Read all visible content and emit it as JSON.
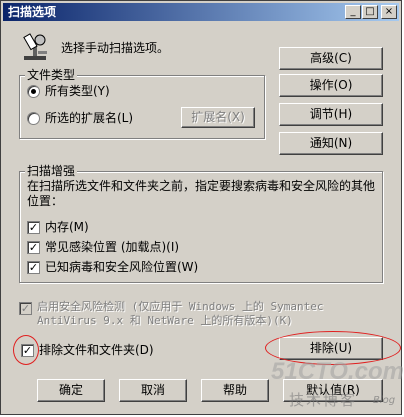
{
  "window": {
    "title": "扫描选项",
    "controls": {
      "minimize": "_",
      "maximize": "□",
      "close": "×"
    }
  },
  "header": {
    "instruction": "选择手动扫描选项。",
    "icon": "microscope-icon"
  },
  "side_buttons": {
    "advanced": "高级(C)",
    "actions": "操作(O)",
    "tuning": "调节(H)",
    "notify": "通知(N)"
  },
  "file_types": {
    "group_label": "文件类型",
    "all_types": "所有类型(Y)",
    "selected_ext": "所选的扩展名(L)",
    "extensions_button": "扩展名(X)",
    "selected": "all_types"
  },
  "scan_enhance": {
    "group_label": "扫描增强",
    "description": "在扫描所选文件和文件夹之前，指定要搜索病毒和安全风险的其他位置：",
    "items": [
      {
        "label": "内存(M)",
        "checked": true
      },
      {
        "label": "常见感染位置 (加载点)(I)",
        "checked": true
      },
      {
        "label": "已知病毒和安全风险位置(W)",
        "checked": true
      }
    ]
  },
  "security_risk": {
    "label_line1": "启用安全风险检测 (仅应用于 Windows 上的 Symantec",
    "label_line2": "AntiVirus 9.x 和 NetWare 上的所有版本)(K)",
    "checked": true,
    "disabled": true
  },
  "exclude": {
    "label": "排除文件和文件夹(D)",
    "checked": true,
    "button": "排除(U)"
  },
  "footer": {
    "ok": "确定",
    "cancel": "取消",
    "help": "帮助",
    "reset": "默认值(R)"
  },
  "watermark": {
    "site": "51CTO.com",
    "tagline": "技术博客",
    "blog": "Blog"
  }
}
